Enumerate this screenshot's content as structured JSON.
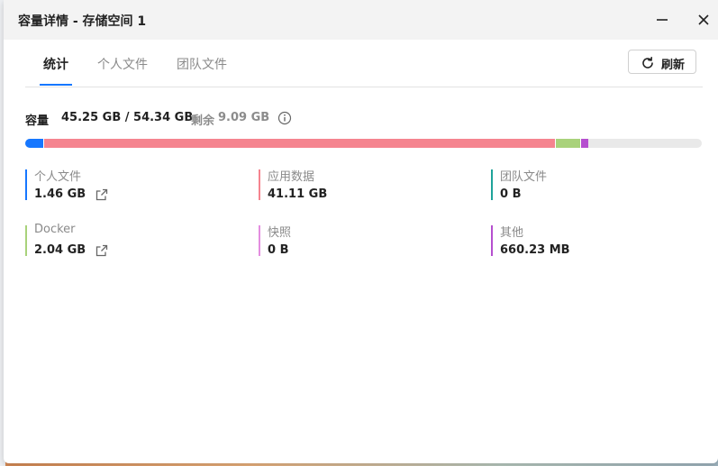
{
  "dialog": {
    "title": "容量详情 - 存储空间 1"
  },
  "tabs": [
    {
      "label": "统计",
      "active": true
    },
    {
      "label": "个人文件",
      "active": false
    },
    {
      "label": "团队文件",
      "active": false
    }
  ],
  "toolbar": {
    "refresh_label": "刷新",
    "refresh_icon": "refresh-icon"
  },
  "capacity": {
    "label": "容量",
    "used_total": "45.25 GB / 54.34 GB",
    "remaining_label": "剩余",
    "remaining": "9.09 GB",
    "info_icon": "info-icon",
    "total_gb": 54.34
  },
  "usage": [
    {
      "key": "personal",
      "label": "个人文件",
      "value": "1.46 GB",
      "gb": 1.46,
      "color": "#1677ff",
      "external_link": true
    },
    {
      "key": "apps",
      "label": "应用数据",
      "value": "41.11 GB",
      "gb": 41.11,
      "color": "#f5848f",
      "external_link": false
    },
    {
      "key": "team",
      "label": "团队文件",
      "value": "0 B",
      "gb": 0,
      "color": "#1fa39a",
      "external_link": false
    },
    {
      "key": "docker",
      "label": "Docker",
      "value": "2.04 GB",
      "gb": 2.04,
      "color": "#a9d27b",
      "external_link": true
    },
    {
      "key": "snapshot",
      "label": "快照",
      "value": "0 B",
      "gb": 0,
      "color": "#e48ee0",
      "external_link": false
    },
    {
      "key": "other",
      "label": "其他",
      "value": "660.23 MB",
      "gb": 0.66,
      "color": "#b54fcf",
      "external_link": false
    }
  ],
  "colors": {
    "accent": "#1677ff",
    "bar_track": "#e9e9e9"
  }
}
